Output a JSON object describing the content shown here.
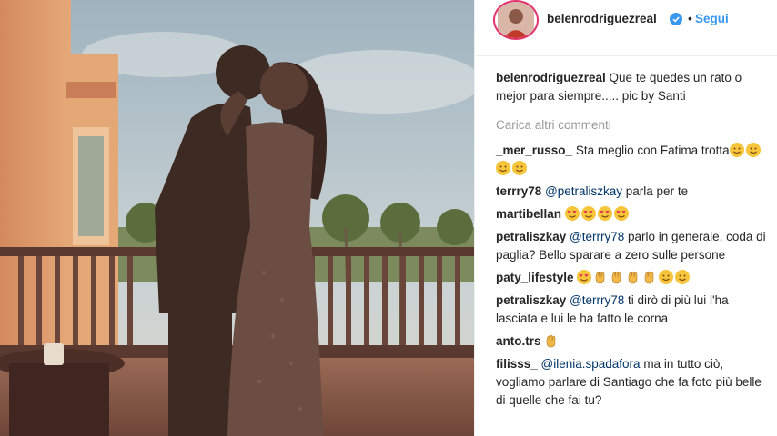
{
  "post": {
    "username": "belenrodriguezreal",
    "separator": "•",
    "follow_label": "Segui",
    "verified_icon": "verified-badge-icon"
  },
  "caption": {
    "user": "belenrodriguezreal",
    "text": " Que te quedes un rato o mejor para siempre..... pic by Santi"
  },
  "load_more_label": "Carica altri commenti",
  "comments": [
    {
      "user": "_mer_russo_",
      "text": " Sta meglio con Fatima trotta",
      "emoji": [
        "crying-laughing",
        "upside-down",
        "wink",
        "smile"
      ]
    },
    {
      "user": "terrry78",
      "mention": " @petraliszkay",
      "text": " parla per te",
      "emoji": []
    },
    {
      "user": "martibellan",
      "text": " ",
      "emoji": [
        "heart-eyes",
        "heart-eyes",
        "heart-eyes",
        "heart-eyes"
      ]
    },
    {
      "user": "petraliszkay",
      "mention": " @terrry78",
      "text": " parlo in generale, coda di paglia? Bello sparare a zero sulle persone",
      "emoji": []
    },
    {
      "user": "paty_lifestyle",
      "text": " ",
      "emoji": [
        "heart-eyes",
        "folded-hands",
        "clap",
        "clap",
        "clap",
        "smile",
        "smile"
      ]
    },
    {
      "user": "petraliszkay",
      "mention": " @terrry78",
      "text": " ti dirò di più lui l'ha lasciata e lui le ha fatto le corna",
      "emoji": []
    },
    {
      "user": "anto.trs",
      "text": " ",
      "emoji": [
        "raised-hands"
      ]
    },
    {
      "user": "filisss_",
      "mention": "  @ilenia.spadafora",
      "text": " ma in tutto ciò, vogliamo parlare di Santiago che fa foto più belle di quelle che fai tu?",
      "emoji": []
    }
  ],
  "colors": {
    "link": "#3897f0",
    "mention": "#003569",
    "muted": "#999999",
    "text": "#262626"
  }
}
